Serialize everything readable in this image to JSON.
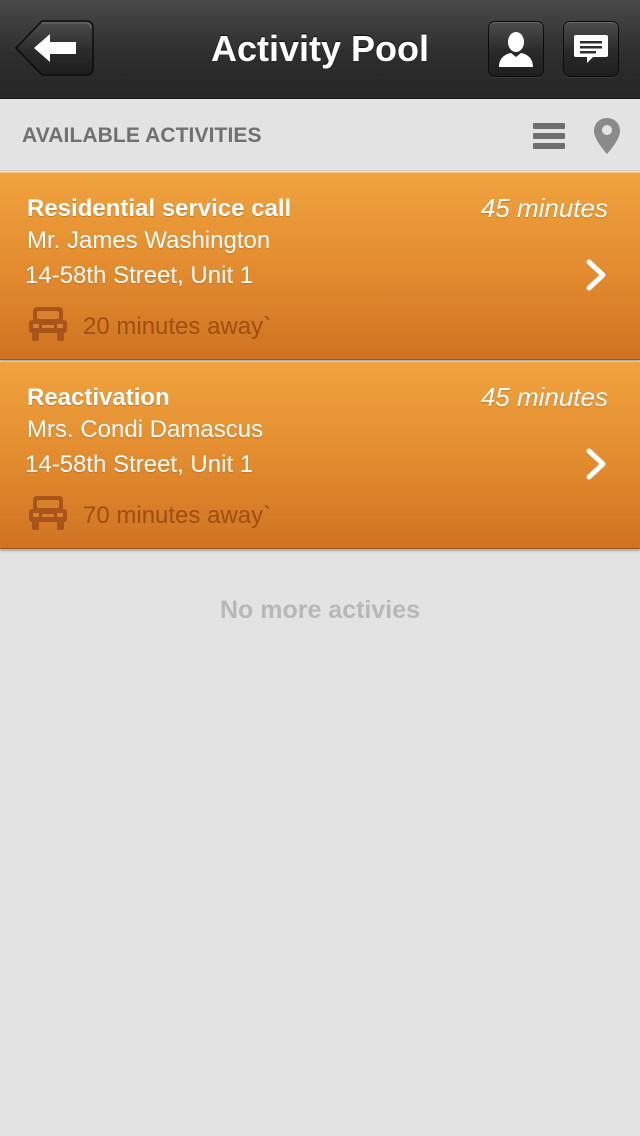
{
  "navbar": {
    "title": "Activity Pool",
    "back_icon": "back-arrow-icon",
    "profile_icon": "person-icon",
    "messages_icon": "chat-bubble-icon"
  },
  "section": {
    "title": "AVAILABLE ACTIVITIES",
    "list_icon": "list-view-icon",
    "map_icon": "map-pin-icon"
  },
  "activities": [
    {
      "type": "Residential service call",
      "duration": "45 minutes",
      "customer": "Mr. James Washington",
      "address": "14-58th Street, Unit 1",
      "distance": "20 minutes away`"
    },
    {
      "type": "Reactivation",
      "duration": "45 minutes",
      "customer": "Mrs. Condi Damascus",
      "address": "14-58th Street, Unit 1",
      "distance": "70 minutes away`"
    }
  ],
  "empty_message": "No more activies",
  "colors": {
    "nav_background": "#2e2e2e",
    "card_orange": "#e18a2e",
    "distance_text": "#9e4f12",
    "page_background": "#e3e3e3"
  }
}
